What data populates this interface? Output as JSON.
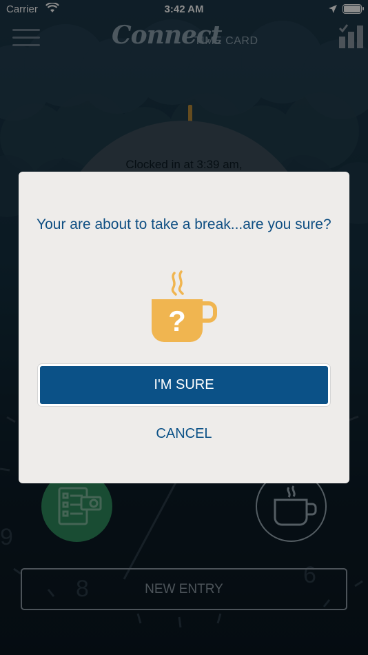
{
  "status_bar": {
    "carrier": "Carrier",
    "time": "3:42 AM"
  },
  "header": {
    "brand": "Connect",
    "subtitle": "TIME CARD"
  },
  "main": {
    "clock_status": "Clocked in at 3:39 am,",
    "new_entry_label": "NEW ENTRY"
  },
  "modal": {
    "message": "Your are about to take a break...are you sure?",
    "confirm_label": "I'M SURE",
    "cancel_label": "CANCEL",
    "icon": "coffee-cup-question-icon"
  },
  "colors": {
    "primary_blue": "#0b5187",
    "message_blue": "#0e4e82",
    "cup_orange": "#f0b550",
    "green_action": "#2f8a5e",
    "modal_bg": "#eeecea"
  }
}
